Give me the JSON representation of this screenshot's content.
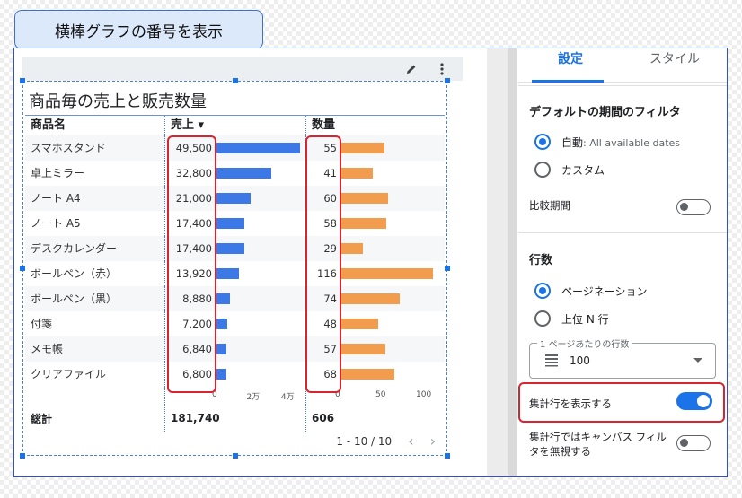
{
  "callout": {
    "title": "横棒グラフの番号を表示"
  },
  "chart": {
    "title": "商品毎の売上と販売数量",
    "headers": {
      "name": "商品名",
      "sales": "売上 ▾",
      "qty": "数量"
    },
    "total_label": "総計",
    "sales_axis": [
      "0",
      "2万",
      "4万"
    ],
    "qty_axis": [
      "0",
      "50",
      "100"
    ],
    "pager": "1 - 10 / 10",
    "bar_colors": {
      "sales": "#3c78e6",
      "qty": "#f29c4d"
    }
  },
  "chart_data": {
    "type": "table",
    "categories": [
      "スマホスタンド",
      "卓上ミラー",
      "ノート A4",
      "ノート A5",
      "デスクカレンダー",
      "ボールペン（赤）",
      "ボールペン（黒）",
      "付箋",
      "メモ帳",
      "クリアファイル"
    ],
    "series": [
      {
        "name": "売上",
        "values": [
          49500,
          32800,
          21000,
          17400,
          17400,
          13920,
          8880,
          7200,
          6840,
          6800
        ],
        "labels": [
          "49,500",
          "32,800",
          "21,000",
          "17,400",
          "17,400",
          "13,920",
          "8,880",
          "7,200",
          "6,840",
          "6,800"
        ],
        "xlim": [
          0,
          52000
        ]
      },
      {
        "name": "数量",
        "values": [
          55,
          41,
          60,
          58,
          29,
          116,
          74,
          48,
          57,
          68
        ],
        "labels": [
          "55",
          "41",
          "60",
          "58",
          "29",
          "116",
          "74",
          "48",
          "57",
          "68"
        ],
        "xlim": [
          0,
          120
        ]
      }
    ],
    "totals": {
      "sales": "181,740",
      "qty": "606"
    }
  },
  "panel": {
    "tabs": [
      "設定",
      "スタイル"
    ],
    "default_period_title": "デフォルトの期間のフィルタ",
    "radio_auto": "自動",
    "radio_auto_sub": ": All available dates",
    "radio_custom": "カスタム",
    "compare_label": "比較期間",
    "rows_title": "行数",
    "radio_pagination": "ページネーション",
    "radio_topn": "上位 N 行",
    "rows_per_page_label": "1 ページあたりの行数",
    "rows_per_page_value": "100",
    "show_totals_label": "集計行を表示する",
    "ignore_filter_label_1": "集計行ではキャンバス フィル",
    "ignore_filter_label_2": "タを無視する"
  }
}
